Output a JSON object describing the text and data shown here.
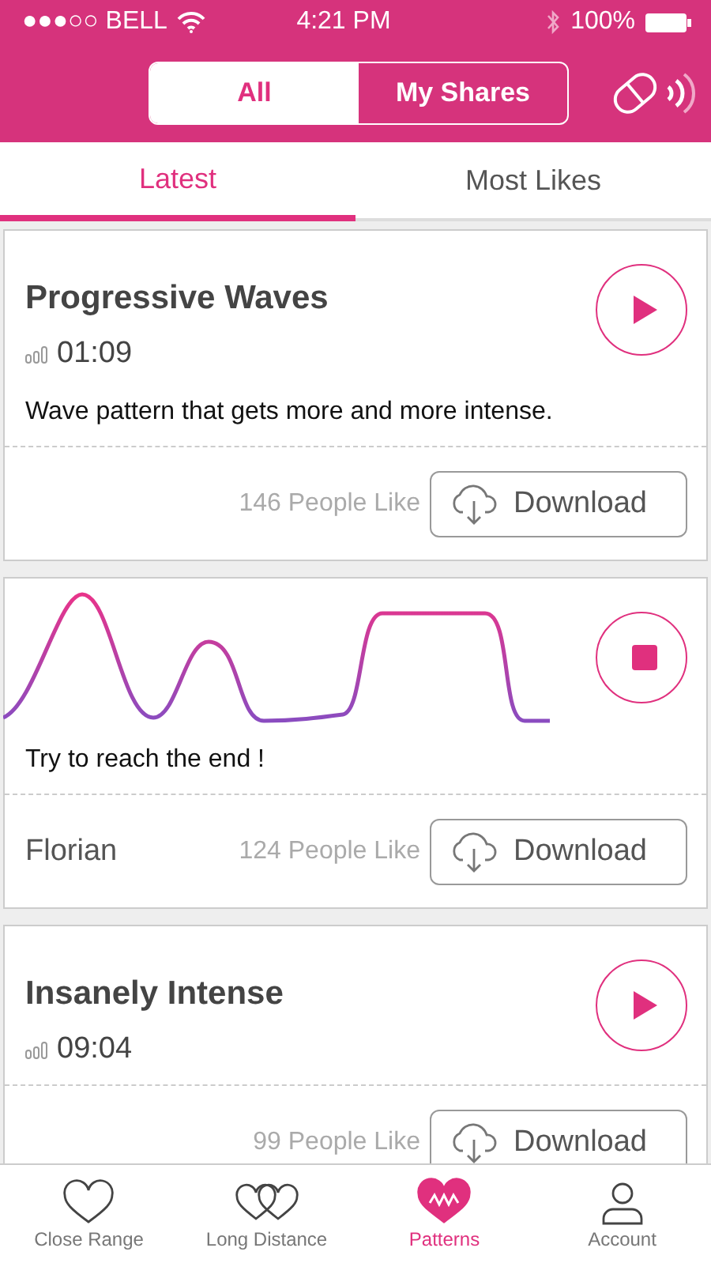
{
  "status_bar": {
    "carrier": "●●●○○ BELL",
    "time": "4:21 PM",
    "battery": "100%"
  },
  "segments": [
    {
      "label": "All",
      "selected": true
    },
    {
      "label": "My Shares",
      "selected": false
    }
  ],
  "tabs": [
    {
      "label": "Latest",
      "selected": true
    },
    {
      "label": "Most Likes",
      "selected": false
    }
  ],
  "patterns": [
    {
      "kind": "info",
      "title": "Progressive Waves",
      "duration": "01:09",
      "playing": false,
      "description": "Wave pattern that gets more and more intense.",
      "likes": "146 People Like",
      "download": "Download"
    },
    {
      "kind": "wave",
      "playing": true,
      "description": "Try to reach the end !",
      "author": "Florian",
      "likes": "124 People Like",
      "download": "Download"
    },
    {
      "kind": "info",
      "title": "Insanely Intense",
      "duration": "09:04",
      "playing": false,
      "likes": "99 People Like",
      "download": "Download"
    }
  ],
  "tab_bar": [
    {
      "label": "Close Range",
      "kind": "heart",
      "selected": false
    },
    {
      "label": "Long Distance",
      "kind": "hearts",
      "selected": false
    },
    {
      "label": "Patterns",
      "kind": "pulse",
      "selected": true
    },
    {
      "label": "Account",
      "kind": "person",
      "selected": false
    }
  ]
}
